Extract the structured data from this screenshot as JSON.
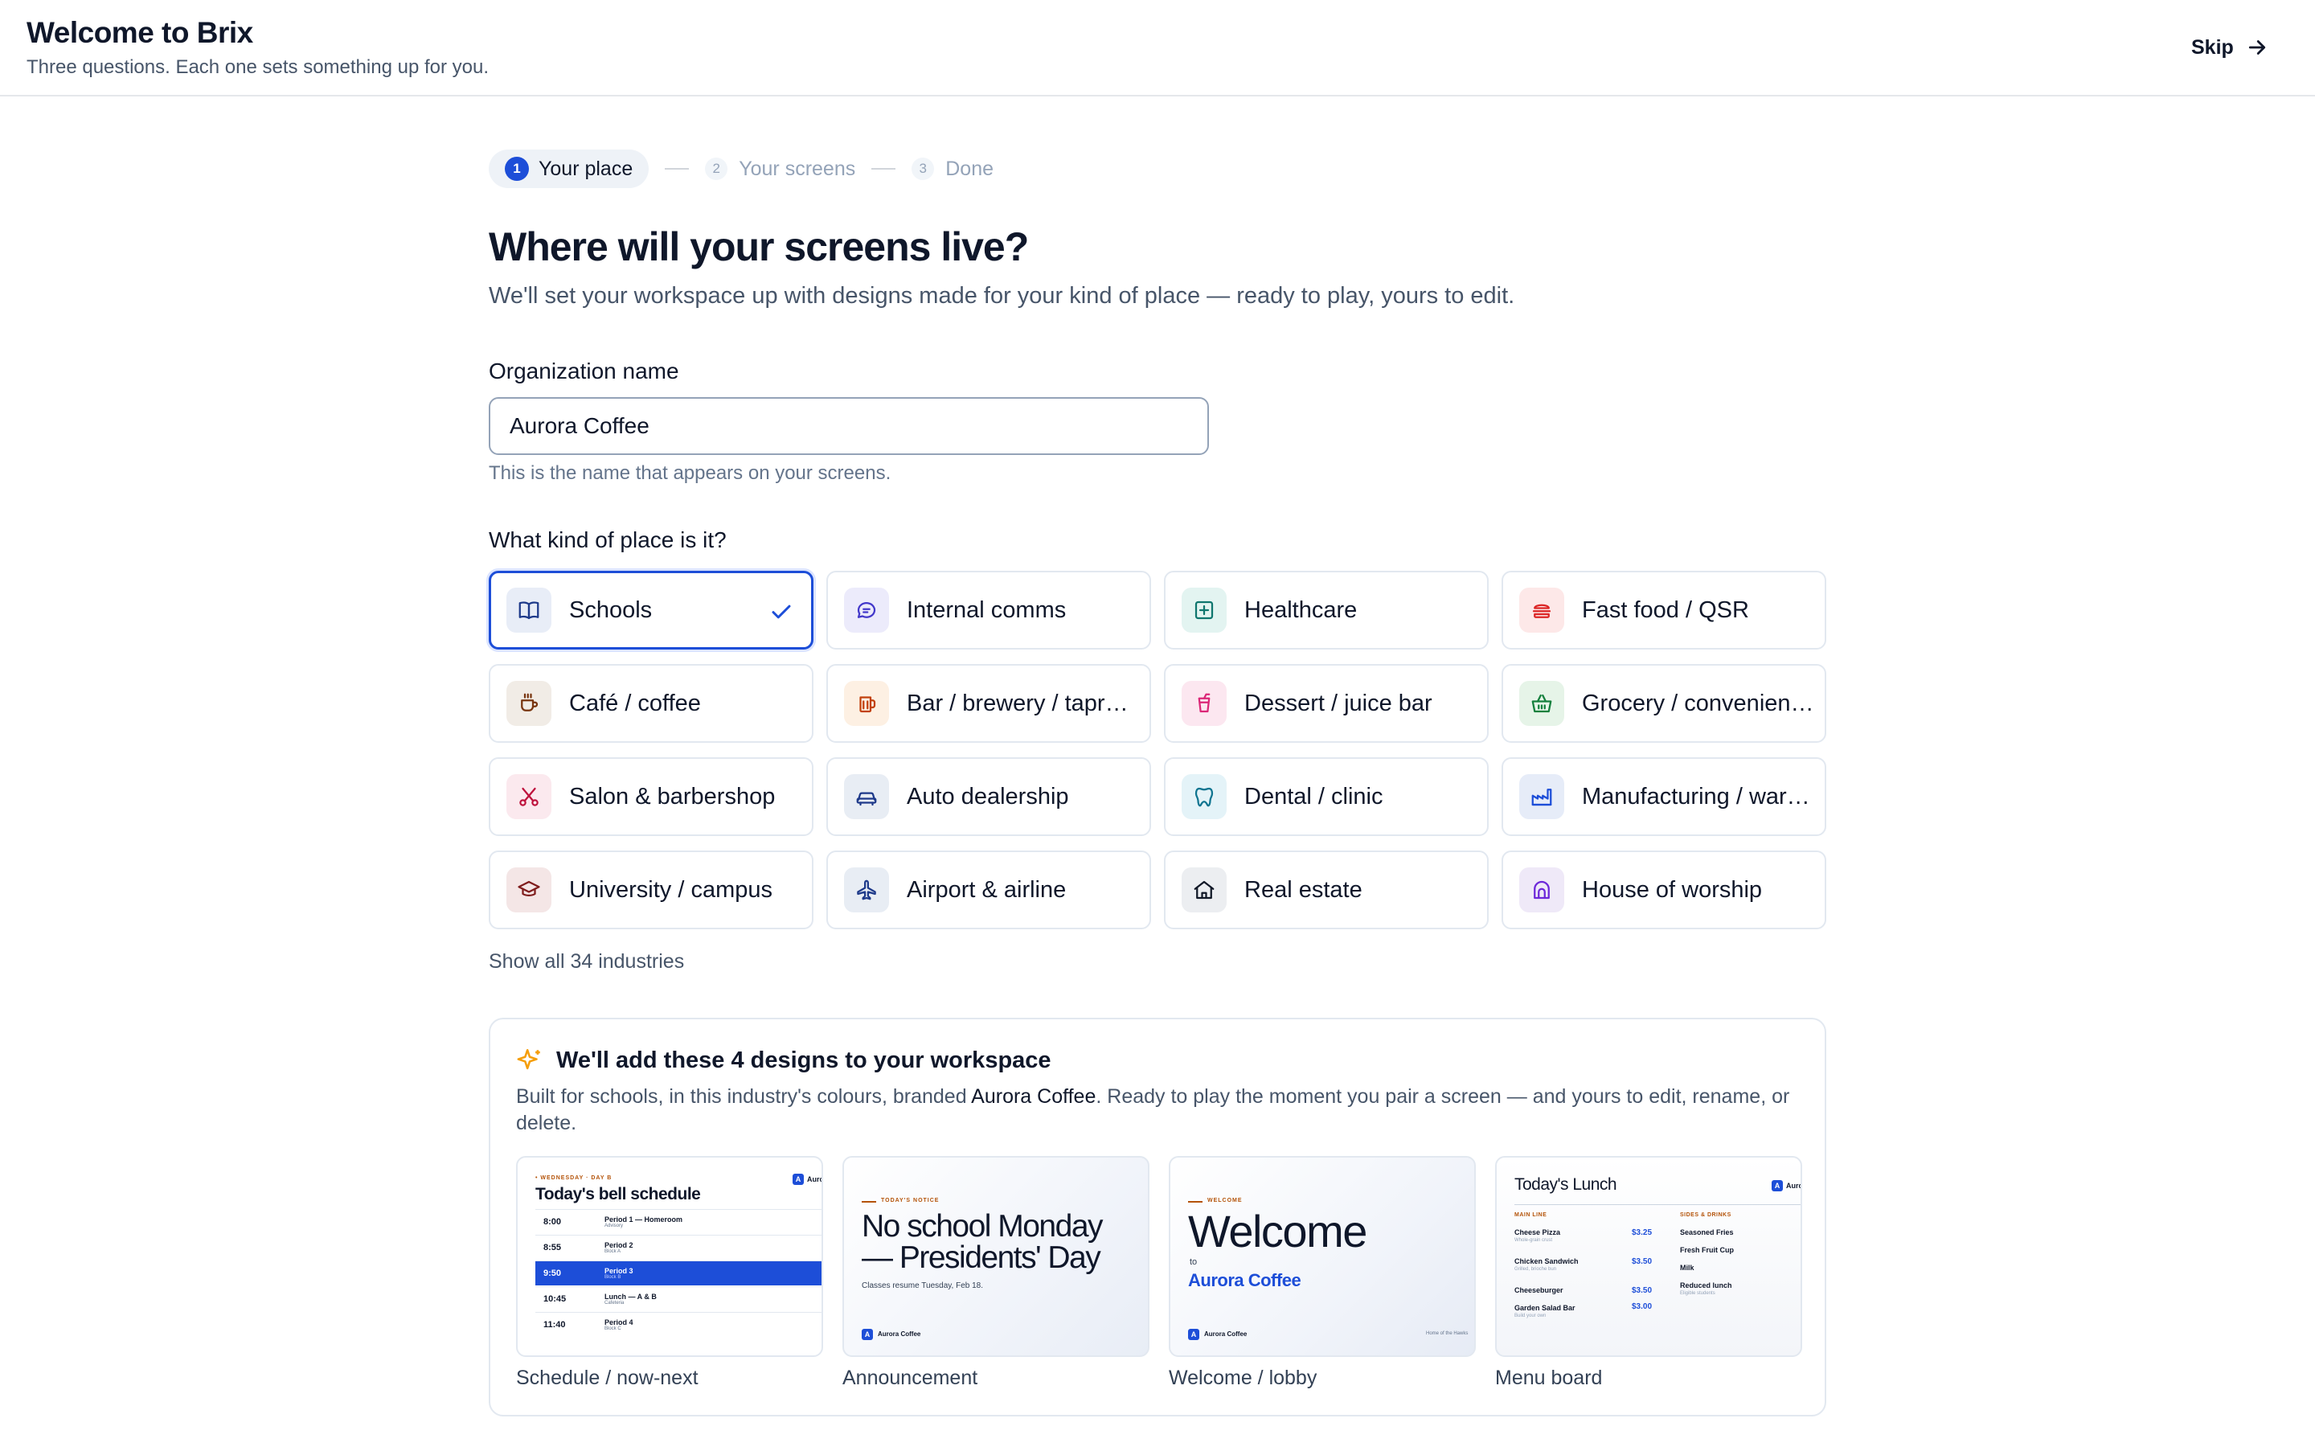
{
  "header": {
    "title": "Welcome to Brix",
    "subtitle": "Three questions. Each one sets something up for you.",
    "skip_label": "Skip"
  },
  "stepper": {
    "steps": [
      {
        "num": "1",
        "label": "Your place",
        "state": "active"
      },
      {
        "num": "2",
        "label": "Your screens",
        "state": "upcoming"
      },
      {
        "num": "3",
        "label": "Done",
        "state": "upcoming"
      }
    ]
  },
  "main": {
    "heading": "Where will your screens live?",
    "lead": "We'll set your workspace up with designs made for your kind of place — ready to play, yours to edit.",
    "org_label": "Organization name",
    "org_value": "Aurora Coffee",
    "org_hint": "This is the name that appears on your screens.",
    "kind_label": "What kind of place is it?",
    "show_all": "Show all 34 industries"
  },
  "industries": [
    {
      "label": "Schools",
      "icon": "book-icon",
      "selected": true
    },
    {
      "label": "Internal comms",
      "icon": "chat-icon"
    },
    {
      "label": "Healthcare",
      "icon": "medical-cross-icon"
    },
    {
      "label": "Fast food / QSR",
      "icon": "burger-icon"
    },
    {
      "label": "Café / coffee",
      "icon": "coffee-cup-icon"
    },
    {
      "label": "Bar / brewery / taproom",
      "icon": "beer-mug-icon"
    },
    {
      "label": "Dessert / juice bar",
      "icon": "juice-cup-icon"
    },
    {
      "label": "Grocery / convenience",
      "icon": "basket-icon"
    },
    {
      "label": "Salon & barbershop",
      "icon": "scissors-icon"
    },
    {
      "label": "Auto dealership",
      "icon": "car-icon"
    },
    {
      "label": "Dental / clinic",
      "icon": "tooth-icon"
    },
    {
      "label": "Manufacturing / warehouse",
      "icon": "factory-icon"
    },
    {
      "label": "University / campus",
      "icon": "graduation-cap-icon"
    },
    {
      "label": "Airport & airline",
      "icon": "airplane-icon"
    },
    {
      "label": "Real estate",
      "icon": "house-icon"
    },
    {
      "label": "House of worship",
      "icon": "arch-icon"
    }
  ],
  "colors": {
    "accent": "#1d4ed8",
    "selected_border": "#1d4ed8",
    "sparkle": "#f59e0b"
  },
  "designs": {
    "title": "We'll add these 4 designs to your workspace",
    "desc_pre": "Built for schools, in this industry's colours, branded ",
    "desc_brand": "Aurora Coffee",
    "desc_post": ". Ready to play the moment you pair a screen — and yours to edit, rename, or delete.",
    "cards": [
      {
        "label": "Schedule / now-next",
        "kicker": "• WEDNESDAY · DAY B",
        "title": "Today's bell schedule",
        "brand": "Aurora",
        "rows": [
          {
            "time": "8:00",
            "name": "Period 1 — Homeroom",
            "sub": "Advisory"
          },
          {
            "time": "8:55",
            "name": "Period 2",
            "sub": "Block A"
          },
          {
            "time": "9:50",
            "name": "Period 3",
            "sub": "Block B"
          },
          {
            "time": "10:45",
            "name": "Lunch — A & B",
            "sub": "Cafeteria"
          },
          {
            "time": "11:40",
            "name": "Period 4",
            "sub": "Block C"
          }
        ]
      },
      {
        "label": "Announcement",
        "kicker": "TODAY'S NOTICE",
        "title_line1": "No school Monday",
        "title_line2": "— Presidents' Day",
        "body": "Classes resume Tuesday, Feb 18.",
        "brand": "Aurora Coffee"
      },
      {
        "label": "Welcome / lobby",
        "kicker": "WELCOME",
        "title": "Welcome",
        "to": "to",
        "brand_line": "Aurora Coffee",
        "brand": "Aurora Coffee",
        "footer": "Home of the Hawks"
      },
      {
        "label": "Menu board",
        "title": "Today's Lunch",
        "brand": "Auro",
        "col1_head": "MAIN LINE",
        "col2_head": "SIDES & DRINKS",
        "items": [
          {
            "name": "Cheese Pizza",
            "sub": "Whole-grain crust",
            "price": "$3.25"
          },
          {
            "name": "Chicken Sandwich",
            "sub": "Grilled, brioche bun",
            "price": "$3.50"
          },
          {
            "name": "Cheeseburger",
            "sub": "",
            "price": "$3.50"
          },
          {
            "name": "Garden Salad Bar",
            "sub": "Build your own",
            "price": "$3.00"
          }
        ],
        "sides": [
          {
            "name": "Seasoned Fries",
            "sub": ""
          },
          {
            "name": "Fresh Fruit Cup",
            "sub": ""
          },
          {
            "name": "Milk",
            "sub": ""
          },
          {
            "name": "Reduced lunch",
            "sub": "Eligible students"
          }
        ]
      }
    ]
  }
}
